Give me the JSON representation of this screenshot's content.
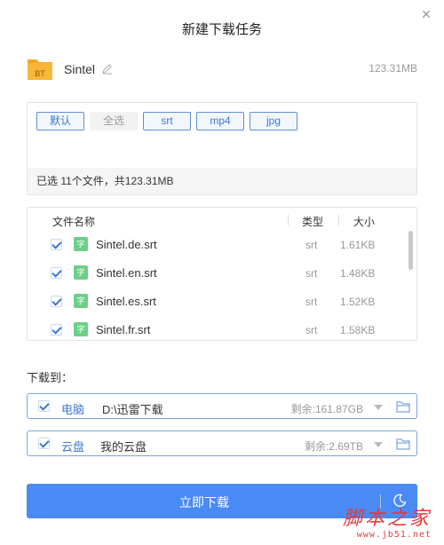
{
  "dialog": {
    "title": "新建下载任务"
  },
  "task": {
    "name": "Sintel",
    "size": "123.31MB",
    "icon_label": "BT"
  },
  "filters": {
    "buttons": [
      {
        "label": "默认",
        "state": "active"
      },
      {
        "label": "全选",
        "state": "plain"
      },
      {
        "label": "srt",
        "state": "active"
      },
      {
        "label": "mp4",
        "state": "active"
      },
      {
        "label": "jpg",
        "state": "active"
      }
    ],
    "summary": "已选 11个文件，共123.31MB"
  },
  "file_list": {
    "headers": {
      "name": "文件名称",
      "type": "类型",
      "size": "大小"
    },
    "rows": [
      {
        "name": "Sintel.de.srt",
        "type": "srt",
        "size": "1.61KB",
        "checked": true,
        "icon": "字"
      },
      {
        "name": "Sintel.en.srt",
        "type": "srt",
        "size": "1.48KB",
        "checked": true,
        "icon": "字"
      },
      {
        "name": "Sintel.es.srt",
        "type": "srt",
        "size": "1.52KB",
        "checked": true,
        "icon": "字"
      },
      {
        "name": "Sintel.fr.srt",
        "type": "srt",
        "size": "1.58KB",
        "checked": true,
        "icon": "字"
      }
    ]
  },
  "download_to": {
    "label": "下载到：",
    "destinations": [
      {
        "name": "电脑",
        "path": "D:\\迅雷下载",
        "free": "剩余:161.87GB",
        "checked": true
      },
      {
        "name": "云盘",
        "path": "我的云盘",
        "free": "剩余:2.69TB",
        "checked": true
      }
    ]
  },
  "start_button": {
    "label": "立即下载"
  },
  "watermark": {
    "text": "脚本之家",
    "url": "www.jb51.net"
  },
  "colors": {
    "accent": "#4a8af4",
    "link": "#3a78d0",
    "watermark": "#e23b3b"
  }
}
